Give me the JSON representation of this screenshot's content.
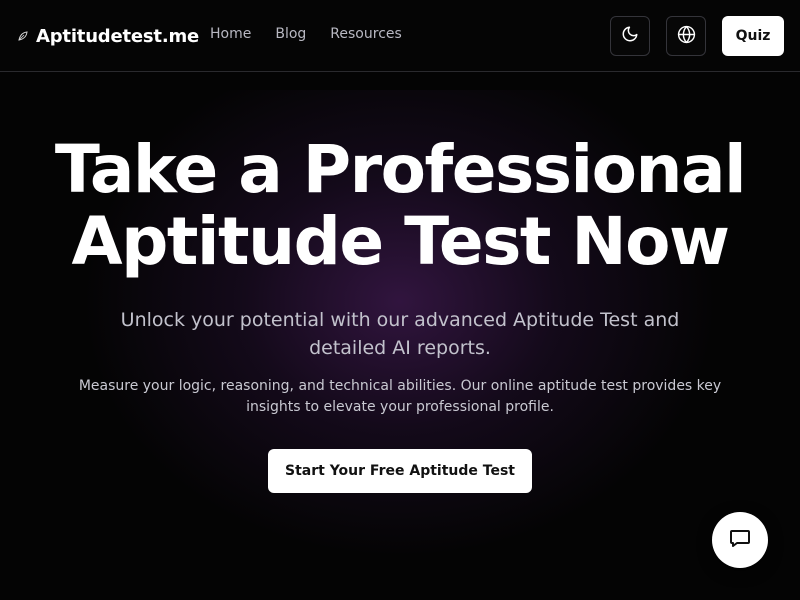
{
  "colors": {
    "background": "#040404",
    "accent_glow": "#56226e",
    "primary_button": "#ffffff",
    "nav_text": "#b8b8c2"
  },
  "header": {
    "brand": {
      "name": "Aptitudetest.me",
      "icon": "leaf-icon"
    },
    "nav": [
      {
        "label": "Home"
      },
      {
        "label": "Blog"
      },
      {
        "label": "Resources"
      }
    ],
    "theme_toggle_icon": "moon-icon",
    "language_icon": "globe-icon",
    "quiz_label": "Quiz"
  },
  "hero": {
    "title_line1": "Take a Professional",
    "title_line2": "Aptitude Test Now",
    "subtitle": "Unlock your potential with our advanced Aptitude Test and detailed AI reports.",
    "description": "Measure your logic, reasoning, and technical abilities. Our online aptitude test provides key insights to elevate your professional profile.",
    "cta_label": "Start Your Free Aptitude Test"
  },
  "chat": {
    "icon": "chat-bubble-icon"
  }
}
